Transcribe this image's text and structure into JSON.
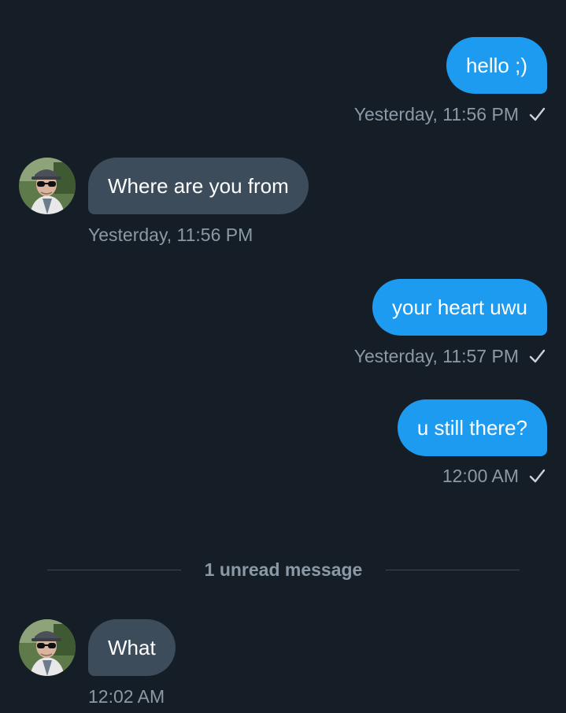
{
  "messages": [
    {
      "direction": "sent",
      "text": "hello ;)",
      "time": "Yesterday, 11:56 PM",
      "status_icon": "check-icon"
    },
    {
      "direction": "received",
      "text": "Where are you from",
      "time": "Yesterday, 11:56 PM",
      "avatar": "sender-avatar"
    },
    {
      "direction": "sent",
      "text": "your heart uwu",
      "time": "Yesterday, 11:57 PM",
      "status_icon": "check-icon"
    },
    {
      "direction": "sent",
      "text": "u still there?",
      "time": "12:00 AM",
      "status_icon": "check-icon"
    },
    {
      "direction": "received",
      "text": "What",
      "time": "12:02 AM",
      "avatar": "sender-avatar"
    }
  ],
  "unread_divider": {
    "label": "1 unread message"
  },
  "colors": {
    "background": "#151e27",
    "sent_bubble": "#1c9bf0",
    "received_bubble": "#3c4c5b",
    "meta_text": "#8b99a6"
  }
}
